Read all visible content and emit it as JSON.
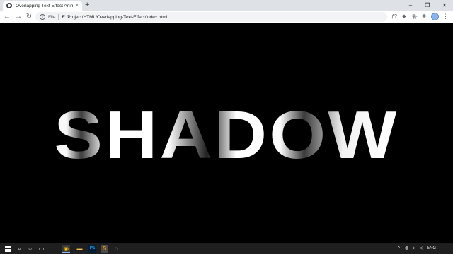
{
  "browser": {
    "tab_title": "Overlapping Text Effect Animation",
    "tab_close": "×",
    "new_tab": "+",
    "window_controls": {
      "minimize": "–",
      "maximize": "❐",
      "close": "✕"
    }
  },
  "toolbar": {
    "back": "←",
    "forward": "→",
    "reload": "↻",
    "info": "i",
    "scheme": "File",
    "url": "E:/Project/HTML/Overlapping-Text-Effect/index.html",
    "star": "☆",
    "menu": "⋮",
    "extensions": [
      "ƒ?",
      "◆",
      "⧉",
      "✱"
    ]
  },
  "page": {
    "headline": "SHADOW"
  },
  "taskbar": {
    "icons": [
      "search-icon",
      "cortana-icon",
      "task-view-icon",
      "chrome-icon",
      "file-explorer-icon",
      "photoshop-icon",
      "sublime-icon",
      "settings-icon"
    ],
    "glyphs": {
      "search": "⌕",
      "cortana": "○",
      "taskview": "▭",
      "chrome": "◉",
      "explorer": "▬",
      "photoshop": "Ps",
      "sublime": "S",
      "settings": "◌"
    },
    "tray": {
      "chevron": "^",
      "globe": "◍",
      "mic": "♪",
      "speaker": "◁",
      "language": "ENG"
    }
  },
  "colors": {
    "page_background": "#000000",
    "taskbar_background": "#1f1f1f",
    "tabstrip_background": "#dee1e6"
  }
}
